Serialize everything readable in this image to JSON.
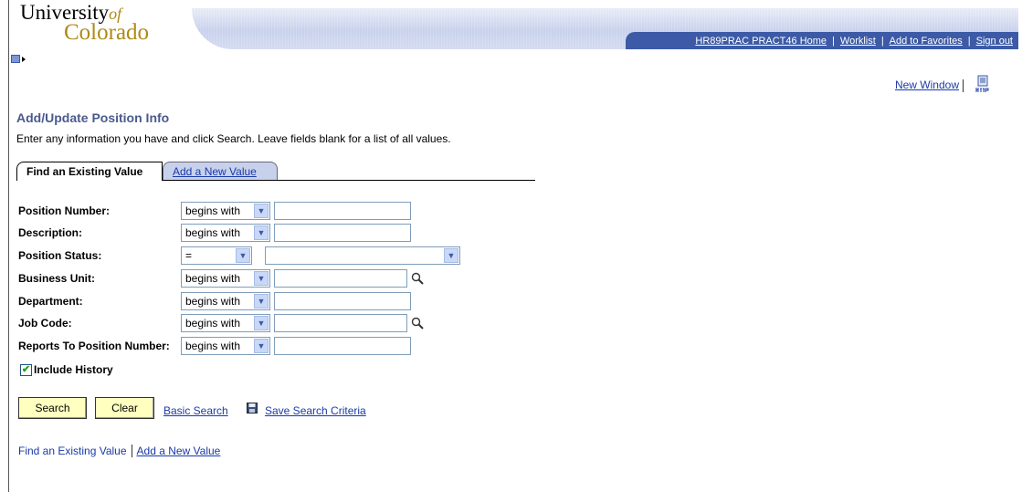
{
  "logo": {
    "line1": "University",
    "of": "of",
    "line2": "Colorado"
  },
  "header_nav": [
    {
      "label": "HR89PRAC PRACT46 Home"
    },
    {
      "label": "Worklist"
    },
    {
      "label": "Add to Favorites"
    },
    {
      "label": "Sign out"
    }
  ],
  "new_window": {
    "label": "New Window"
  },
  "page": {
    "title": "Add/Update Position Info",
    "instructions": "Enter any information you have and click Search. Leave fields blank for a list of all values."
  },
  "tabs": [
    {
      "label": "Find an Existing Value",
      "active": true
    },
    {
      "label": "Add a New Value",
      "active": false
    }
  ],
  "fields": [
    {
      "label": "Position Number:",
      "operator": "begins with",
      "value": "",
      "lookup": false
    },
    {
      "label": "Description:",
      "operator": "begins with",
      "value": "",
      "lookup": false
    },
    {
      "label": "Position Status:",
      "operator": "=",
      "value": "",
      "lookup": false
    },
    {
      "label": "Business Unit:",
      "operator": "begins with",
      "value": "",
      "lookup": true
    },
    {
      "label": "Department:",
      "operator": "begins with",
      "value": "",
      "lookup": false
    },
    {
      "label": "Job Code:",
      "operator": "begins with",
      "value": "",
      "lookup": true
    },
    {
      "label": "Reports To Position Number:",
      "operator": "begins with",
      "value": "",
      "lookup": false
    }
  ],
  "include_history": {
    "label": "Include History",
    "checked": true
  },
  "buttons": {
    "search": "Search",
    "clear": "Clear"
  },
  "links": {
    "basic_search": "Basic Search",
    "save_criteria": "Save Search Criteria"
  },
  "bottom": {
    "find_existing": "Find an Existing Value",
    "add_new": "Add a New Value"
  },
  "colors": {
    "nav_bar": "#3c5aa6",
    "title": "#4a5a8c",
    "link": "#1a3aa8",
    "button": "#ffffc0",
    "logo_gold": "#b08a16"
  }
}
